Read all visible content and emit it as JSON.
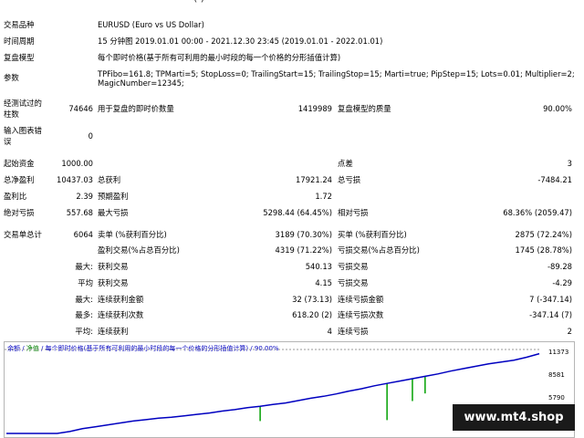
{
  "header": {
    "symbol_label": "交易品种",
    "symbol_value": "EURUSD (Euro vs US Dollar)",
    "period_label": "时间周期",
    "period_value": "15 分钟图 2019.01.01 00:00 - 2021.12.30 23:45 (2019.01.01 - 2022.01.01)",
    "model_label": "复盘模型",
    "model_value": "每个即时价格(基于所有可利用的最小时段的每一个价格的分形插值计算)",
    "params_label": "参数",
    "params_value_1": "TPFibo=161.8; TPMarti=5; StopLoss=0; TrailingStart=15; TrailingStop=15; Marti=true; PipStep=15; Lots=0.01; Multiplier=2;",
    "params_value_2": "MagicNumber=12345;"
  },
  "stats": {
    "bars_label_1": "经测试过的",
    "bars_label_2": "柱数",
    "bars_value": "74646",
    "ticks_label": "用于复盘的即时价数量",
    "ticks_value": "1419989",
    "quality_label": "复盘模型的质量",
    "quality_value": "90.00%",
    "errors_label_1": "输入图表错",
    "errors_label_2": "误",
    "errors_value": "0",
    "deposit_label": "起始资金",
    "deposit_value": "1000.00",
    "spread_label": "点差",
    "spread_value": "3",
    "netprofit_label": "总净盈利",
    "netprofit_value": "10437.03",
    "grossprofit_label": "总获利",
    "grossprofit_value": "17921.24",
    "grossloss_label": "总亏损",
    "grossloss_value": "-7484.21",
    "pf_label": "盈利比",
    "pf_value": "2.39",
    "expected_label": "预期盈利",
    "expected_value": "1.72",
    "absdd_label": "绝对亏损",
    "absdd_value": "557.68",
    "maxdd_label": "最大亏损",
    "maxdd_value": "5298.44 (64.45%)",
    "reldd_label": "相对亏损",
    "reldd_value": "68.36% (2059.47)",
    "total_trades_label": "交易单总计",
    "total_trades_value": "6064",
    "short_label": "卖单 (%获利百分比)",
    "short_value": "3189 (70.30%)",
    "long_label": "买单 (%获利百分比)",
    "long_value": "2875 (72.24%)",
    "profit_trades_label": "盈利交易(%占总百分比)",
    "profit_trades_value": "4319 (71.22%)",
    "loss_trades_label": "亏损交易(%占总百分比)",
    "loss_trades_value": "1745 (28.78%)",
    "largest_prefix": "最大:",
    "largest_profit_label": "获利交易",
    "largest_profit_value": "540.13",
    "largest_loss_label": "亏损交易",
    "largest_loss_value": "-89.28",
    "average_prefix": "平均",
    "average_profit_label": "获利交易",
    "average_profit_value": "4.15",
    "average_loss_label": "亏损交易",
    "average_loss_value": "-4.29",
    "maxcons_prefix": "最大:",
    "maxcons_wins_label": "连续获利金额",
    "maxcons_wins_value": "32 (73.13)",
    "maxcons_losses_label": "连续亏损金额",
    "maxcons_losses_value": "7 (-347.14)",
    "maxconsum_prefix": "最多:",
    "maxconsum_profit_label": "连续获利次数",
    "maxconsum_profit_value": "618.20 (2)",
    "maxconsum_loss_label": "连续亏损次数",
    "maxconsum_loss_value": "-347.14 (7)",
    "avgcons_prefix": "平均:",
    "avgcons_wins_label": "连续获利",
    "avgcons_wins_value": "4",
    "avgcons_losses_label": "连续亏损",
    "avgcons_losses_value": "2"
  },
  "chart": {
    "caption_balance": "余额",
    "caption_sep1": " / ",
    "caption_equity": "净值",
    "caption_rest": " / 每个即时价格(基于所有可利用的最小时段的每一个价格的分形插值计算) / 90.00%",
    "y_labels": [
      "11373",
      "8581",
      "5790"
    ],
    "balance_color": "#0000c0",
    "equity_color": "#00a000"
  },
  "watermark": "www.mt4.shop",
  "chart_data": {
    "type": "line",
    "ylim": [
      3000,
      12200
    ],
    "series": [
      {
        "values": [
          1000,
          1600,
          2100,
          2500,
          2900,
          3200,
          3500,
          3700,
          3900,
          4100,
          4300,
          4450,
          4600,
          4700,
          4850,
          5000,
          5150,
          5350,
          5500,
          5700,
          5850,
          6050,
          6200,
          6450,
          6700,
          6900,
          7150,
          7450,
          7700,
          8000,
          8250,
          8500,
          8750,
          9000,
          9250,
          9550,
          9800,
          10050,
          10300,
          10500,
          10700,
          11000,
          11373
        ]
      }
    ],
    "equity_dips": [
      {
        "i": 20,
        "value": 4300
      },
      {
        "i": 30,
        "value": 4400
      },
      {
        "i": 32,
        "value": 6400
      },
      {
        "i": 33,
        "value": 7200
      }
    ]
  }
}
